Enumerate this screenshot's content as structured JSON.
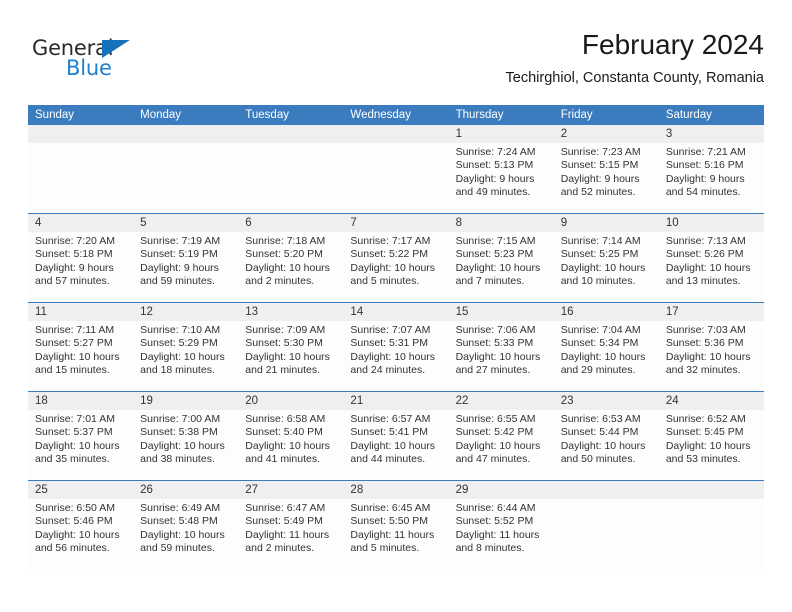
{
  "logo": {
    "word_top": "General",
    "word_bottom": "Blue",
    "triangle_icon": "triangle-icon",
    "color_dark": "#2b2b2b",
    "color_blue": "#1f7fd0"
  },
  "header": {
    "title": "February 2024",
    "subtitle": "Techirghiol, Constanta County, Romania"
  },
  "colors": {
    "header_blue": "#3b7cbf",
    "daynum_band": "#efefef",
    "cell_background": "#fdfdfd",
    "text": "#333333"
  },
  "calendar": {
    "weekday_headers": [
      "Sunday",
      "Monday",
      "Tuesday",
      "Wednesday",
      "Thursday",
      "Friday",
      "Saturday"
    ],
    "weeks": [
      [
        {
          "day": "",
          "lines": []
        },
        {
          "day": "",
          "lines": []
        },
        {
          "day": "",
          "lines": []
        },
        {
          "day": "",
          "lines": []
        },
        {
          "day": "1",
          "lines": [
            "Sunrise: 7:24 AM",
            "Sunset: 5:13 PM",
            "Daylight: 9 hours",
            "and 49 minutes."
          ]
        },
        {
          "day": "2",
          "lines": [
            "Sunrise: 7:23 AM",
            "Sunset: 5:15 PM",
            "Daylight: 9 hours",
            "and 52 minutes."
          ]
        },
        {
          "day": "3",
          "lines": [
            "Sunrise: 7:21 AM",
            "Sunset: 5:16 PM",
            "Daylight: 9 hours",
            "and 54 minutes."
          ]
        }
      ],
      [
        {
          "day": "4",
          "lines": [
            "Sunrise: 7:20 AM",
            "Sunset: 5:18 PM",
            "Daylight: 9 hours",
            "and 57 minutes."
          ]
        },
        {
          "day": "5",
          "lines": [
            "Sunrise: 7:19 AM",
            "Sunset: 5:19 PM",
            "Daylight: 9 hours",
            "and 59 minutes."
          ]
        },
        {
          "day": "6",
          "lines": [
            "Sunrise: 7:18 AM",
            "Sunset: 5:20 PM",
            "Daylight: 10 hours",
            "and 2 minutes."
          ]
        },
        {
          "day": "7",
          "lines": [
            "Sunrise: 7:17 AM",
            "Sunset: 5:22 PM",
            "Daylight: 10 hours",
            "and 5 minutes."
          ]
        },
        {
          "day": "8",
          "lines": [
            "Sunrise: 7:15 AM",
            "Sunset: 5:23 PM",
            "Daylight: 10 hours",
            "and 7 minutes."
          ]
        },
        {
          "day": "9",
          "lines": [
            "Sunrise: 7:14 AM",
            "Sunset: 5:25 PM",
            "Daylight: 10 hours",
            "and 10 minutes."
          ]
        },
        {
          "day": "10",
          "lines": [
            "Sunrise: 7:13 AM",
            "Sunset: 5:26 PM",
            "Daylight: 10 hours",
            "and 13 minutes."
          ]
        }
      ],
      [
        {
          "day": "11",
          "lines": [
            "Sunrise: 7:11 AM",
            "Sunset: 5:27 PM",
            "Daylight: 10 hours",
            "and 15 minutes."
          ]
        },
        {
          "day": "12",
          "lines": [
            "Sunrise: 7:10 AM",
            "Sunset: 5:29 PM",
            "Daylight: 10 hours",
            "and 18 minutes."
          ]
        },
        {
          "day": "13",
          "lines": [
            "Sunrise: 7:09 AM",
            "Sunset: 5:30 PM",
            "Daylight: 10 hours",
            "and 21 minutes."
          ]
        },
        {
          "day": "14",
          "lines": [
            "Sunrise: 7:07 AM",
            "Sunset: 5:31 PM",
            "Daylight: 10 hours",
            "and 24 minutes."
          ]
        },
        {
          "day": "15",
          "lines": [
            "Sunrise: 7:06 AM",
            "Sunset: 5:33 PM",
            "Daylight: 10 hours",
            "and 27 minutes."
          ]
        },
        {
          "day": "16",
          "lines": [
            "Sunrise: 7:04 AM",
            "Sunset: 5:34 PM",
            "Daylight: 10 hours",
            "and 29 minutes."
          ]
        },
        {
          "day": "17",
          "lines": [
            "Sunrise: 7:03 AM",
            "Sunset: 5:36 PM",
            "Daylight: 10 hours",
            "and 32 minutes."
          ]
        }
      ],
      [
        {
          "day": "18",
          "lines": [
            "Sunrise: 7:01 AM",
            "Sunset: 5:37 PM",
            "Daylight: 10 hours",
            "and 35 minutes."
          ]
        },
        {
          "day": "19",
          "lines": [
            "Sunrise: 7:00 AM",
            "Sunset: 5:38 PM",
            "Daylight: 10 hours",
            "and 38 minutes."
          ]
        },
        {
          "day": "20",
          "lines": [
            "Sunrise: 6:58 AM",
            "Sunset: 5:40 PM",
            "Daylight: 10 hours",
            "and 41 minutes."
          ]
        },
        {
          "day": "21",
          "lines": [
            "Sunrise: 6:57 AM",
            "Sunset: 5:41 PM",
            "Daylight: 10 hours",
            "and 44 minutes."
          ]
        },
        {
          "day": "22",
          "lines": [
            "Sunrise: 6:55 AM",
            "Sunset: 5:42 PM",
            "Daylight: 10 hours",
            "and 47 minutes."
          ]
        },
        {
          "day": "23",
          "lines": [
            "Sunrise: 6:53 AM",
            "Sunset: 5:44 PM",
            "Daylight: 10 hours",
            "and 50 minutes."
          ]
        },
        {
          "day": "24",
          "lines": [
            "Sunrise: 6:52 AM",
            "Sunset: 5:45 PM",
            "Daylight: 10 hours",
            "and 53 minutes."
          ]
        }
      ],
      [
        {
          "day": "25",
          "lines": [
            "Sunrise: 6:50 AM",
            "Sunset: 5:46 PM",
            "Daylight: 10 hours",
            "and 56 minutes."
          ]
        },
        {
          "day": "26",
          "lines": [
            "Sunrise: 6:49 AM",
            "Sunset: 5:48 PM",
            "Daylight: 10 hours",
            "and 59 minutes."
          ]
        },
        {
          "day": "27",
          "lines": [
            "Sunrise: 6:47 AM",
            "Sunset: 5:49 PM",
            "Daylight: 11 hours",
            "and 2 minutes."
          ]
        },
        {
          "day": "28",
          "lines": [
            "Sunrise: 6:45 AM",
            "Sunset: 5:50 PM",
            "Daylight: 11 hours",
            "and 5 minutes."
          ]
        },
        {
          "day": "29",
          "lines": [
            "Sunrise: 6:44 AM",
            "Sunset: 5:52 PM",
            "Daylight: 11 hours",
            "and 8 minutes."
          ]
        },
        {
          "day": "",
          "lines": []
        },
        {
          "day": "",
          "lines": []
        }
      ]
    ]
  }
}
